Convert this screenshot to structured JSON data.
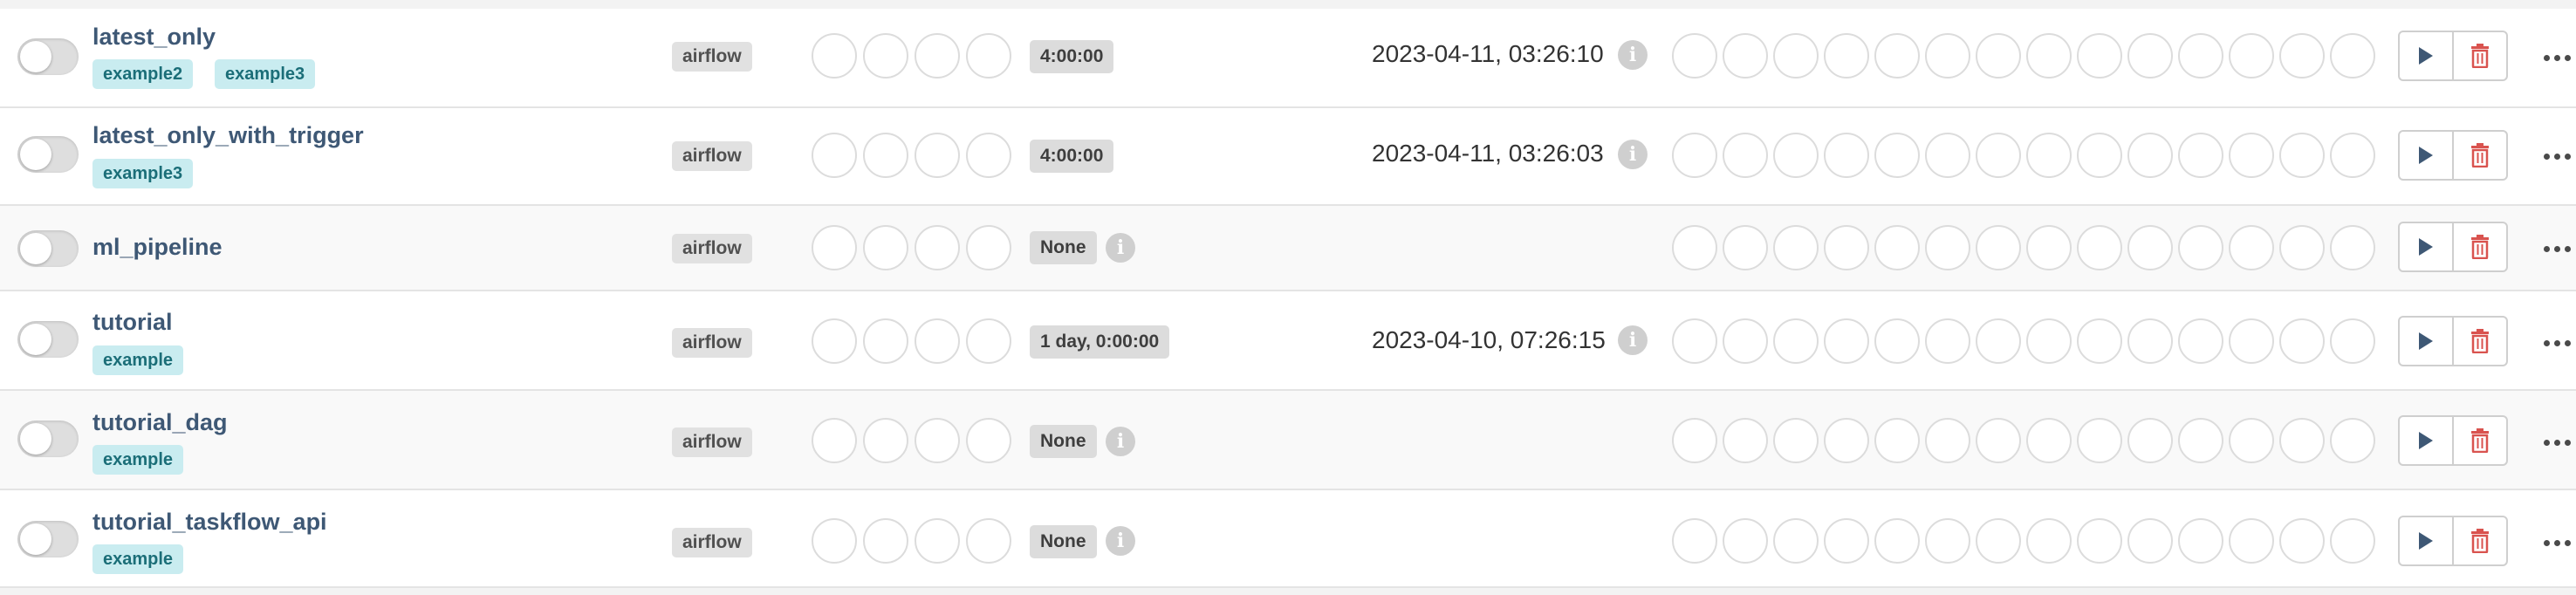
{
  "owner_label": "airflow",
  "rows": [
    {
      "name": "latest_only",
      "tags": [
        "example2",
        "example3"
      ],
      "owner": "airflow",
      "schedule": "4:00:00",
      "last_run": "2023-04-11, 03:26:10",
      "paused": true
    },
    {
      "name": "latest_only_with_trigger",
      "tags": [
        "example3"
      ],
      "owner": "airflow",
      "schedule": "4:00:00",
      "last_run": "2023-04-11, 03:26:03",
      "paused": true
    },
    {
      "name": "ml_pipeline",
      "tags": [],
      "owner": "airflow",
      "schedule": "None",
      "last_run": "",
      "paused": true
    },
    {
      "name": "tutorial",
      "tags": [
        "example"
      ],
      "owner": "airflow",
      "schedule": "1 day, 0:00:00",
      "last_run": "2023-04-10, 07:26:15",
      "paused": true
    },
    {
      "name": "tutorial_dag",
      "tags": [
        "example"
      ],
      "owner": "airflow",
      "schedule": "None",
      "last_run": "",
      "paused": true
    },
    {
      "name": "tutorial_taskflow_api",
      "tags": [
        "example"
      ],
      "owner": "airflow",
      "schedule": "None",
      "last_run": "",
      "paused": true
    }
  ],
  "icons": {
    "info": "info-icon",
    "trigger": "play-icon",
    "delete": "trash-icon",
    "more": "ellipsis-icon"
  },
  "colors": {
    "dag_name": "#3e5875",
    "tag_bg": "#c9ecf0",
    "delete_red": "#d9534f",
    "play": "#3e5875"
  }
}
